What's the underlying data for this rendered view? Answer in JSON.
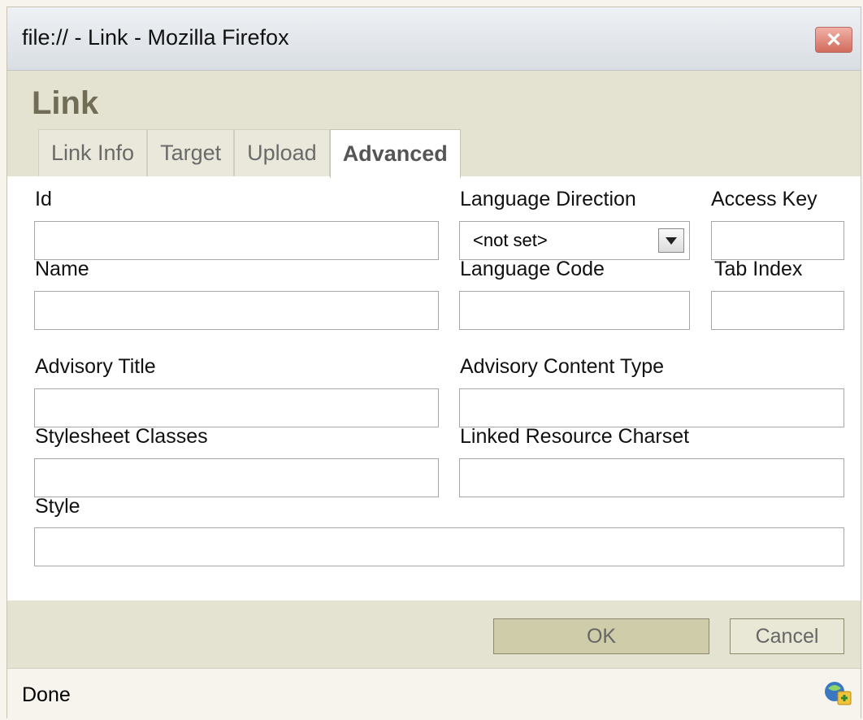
{
  "window": {
    "title": "file:// - Link - Mozilla Firefox",
    "close_glyph": "✕"
  },
  "dialog": {
    "title": "Link",
    "tabs": [
      "Link Info",
      "Target",
      "Upload",
      "Advanced"
    ],
    "active_tab": "Advanced"
  },
  "form": {
    "id_label": "Id",
    "lang_dir_label": "Language Direction",
    "lang_dir_value": "<not set>",
    "access_key_label": "Access Key",
    "name_label": "Name",
    "lang_code_label": "Language Code",
    "tab_index_label": "Tab Index",
    "advisory_title_label": "Advisory Title",
    "advisory_content_type_label": "Advisory Content Type",
    "stylesheet_classes_label": "Stylesheet Classes",
    "linked_charset_label": "Linked Resource Charset",
    "style_label": "Style"
  },
  "buttons": {
    "ok": "OK",
    "cancel": "Cancel"
  },
  "status": {
    "text": "Done"
  },
  "icons": {
    "close": "close-icon",
    "dropdown": "chevron-down-icon",
    "status": "connection-status-icon"
  }
}
